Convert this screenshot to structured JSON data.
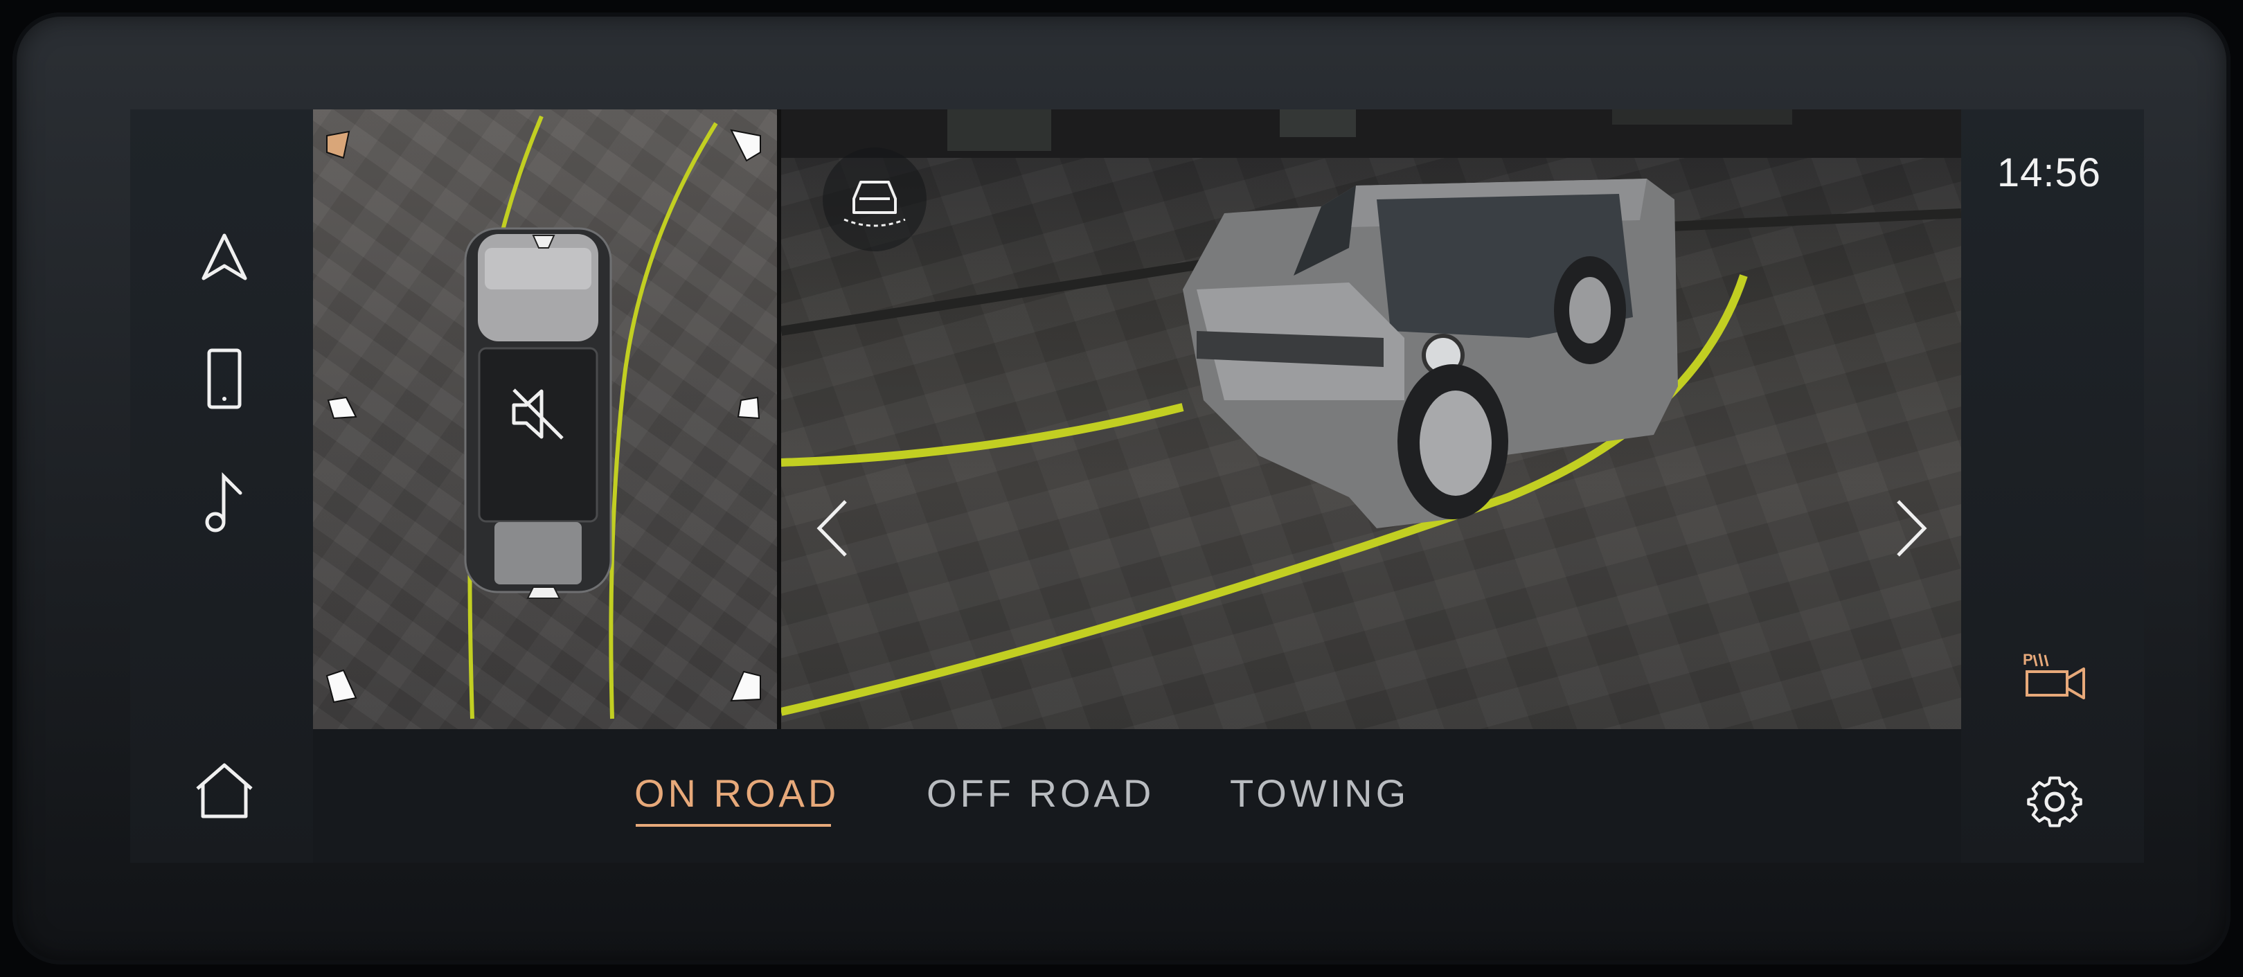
{
  "status": {
    "clock": "14:56"
  },
  "tabs": [
    {
      "label": "ON ROAD",
      "active": true
    },
    {
      "label": "OFF ROAD",
      "active": false
    },
    {
      "label": "TOWING",
      "active": false
    }
  ],
  "left_nav": [
    {
      "icon": "navigation-arrow-icon"
    },
    {
      "icon": "phone-icon"
    },
    {
      "icon": "music-note-icon"
    },
    {
      "icon": "home-icon"
    }
  ],
  "right_nav": [
    {
      "icon": "park-assist-camera-icon"
    },
    {
      "icon": "settings-gear-icon"
    }
  ],
  "colors": {
    "accent": "#e7a97a",
    "guide_line": "#c2cf22",
    "text": "#f2f2f2",
    "inactive_tab": "#b9bcc0"
  }
}
